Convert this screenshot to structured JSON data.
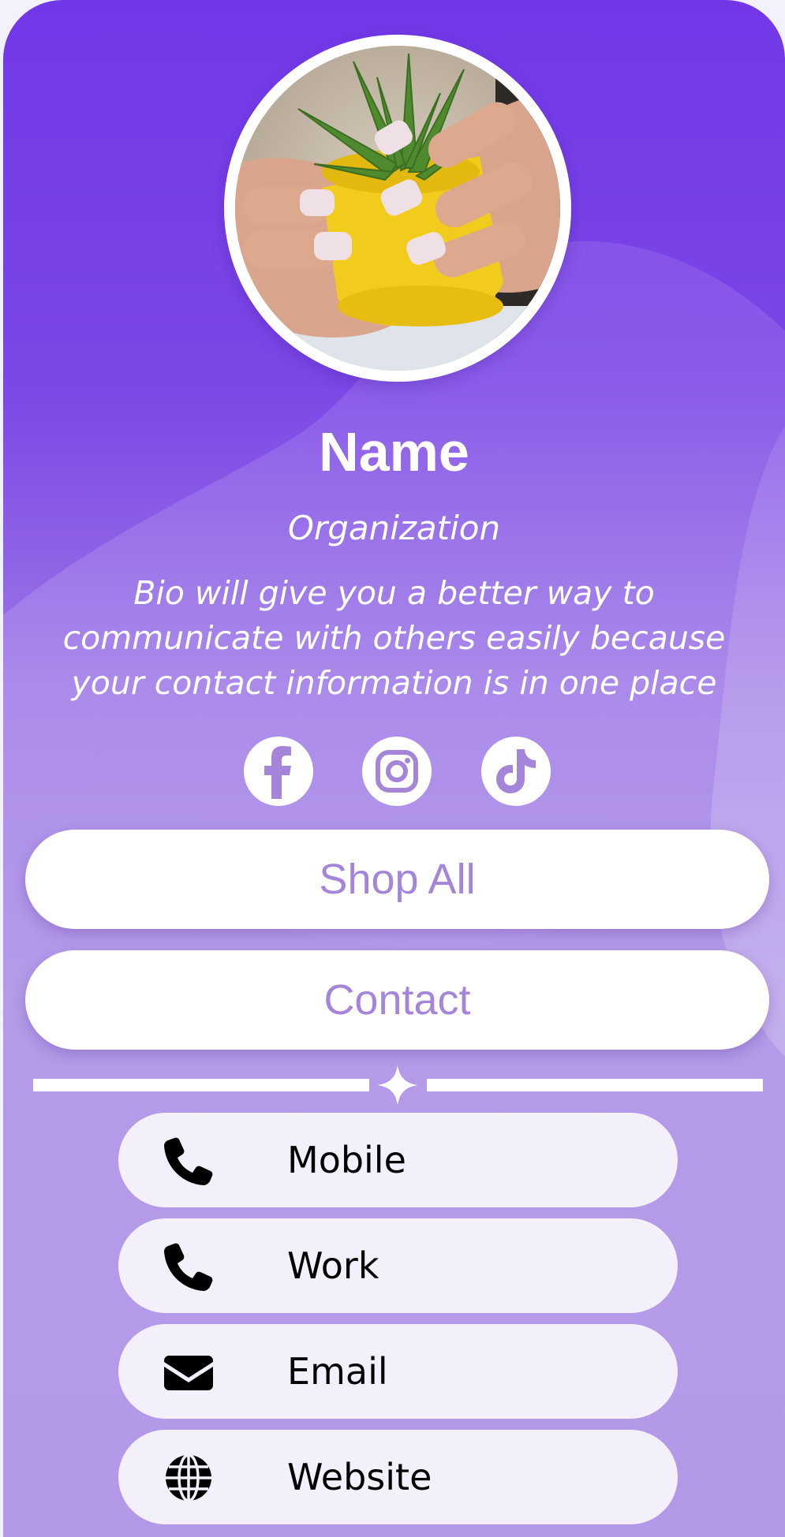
{
  "profile": {
    "name": "Name",
    "organization": "Organization",
    "bio": "Bio will give you a better way to communicate with others easily because your contact information is in one place"
  },
  "social_links": [
    {
      "icon": "facebook-icon"
    },
    {
      "icon": "instagram-icon"
    },
    {
      "icon": "tiktok-icon"
    }
  ],
  "buttons": {
    "shop_all": "Shop All",
    "contact": "Contact"
  },
  "contacts": [
    {
      "label": "Mobile",
      "icon": "phone-icon"
    },
    {
      "label": "Work",
      "icon": "phone-icon"
    },
    {
      "label": "Email",
      "icon": "envelope-icon"
    },
    {
      "label": "Website",
      "icon": "globe-icon"
    }
  ],
  "colors": {
    "primary": "#7238e8",
    "accent_text": "#a585d9",
    "row_bg": "#f3effb"
  }
}
